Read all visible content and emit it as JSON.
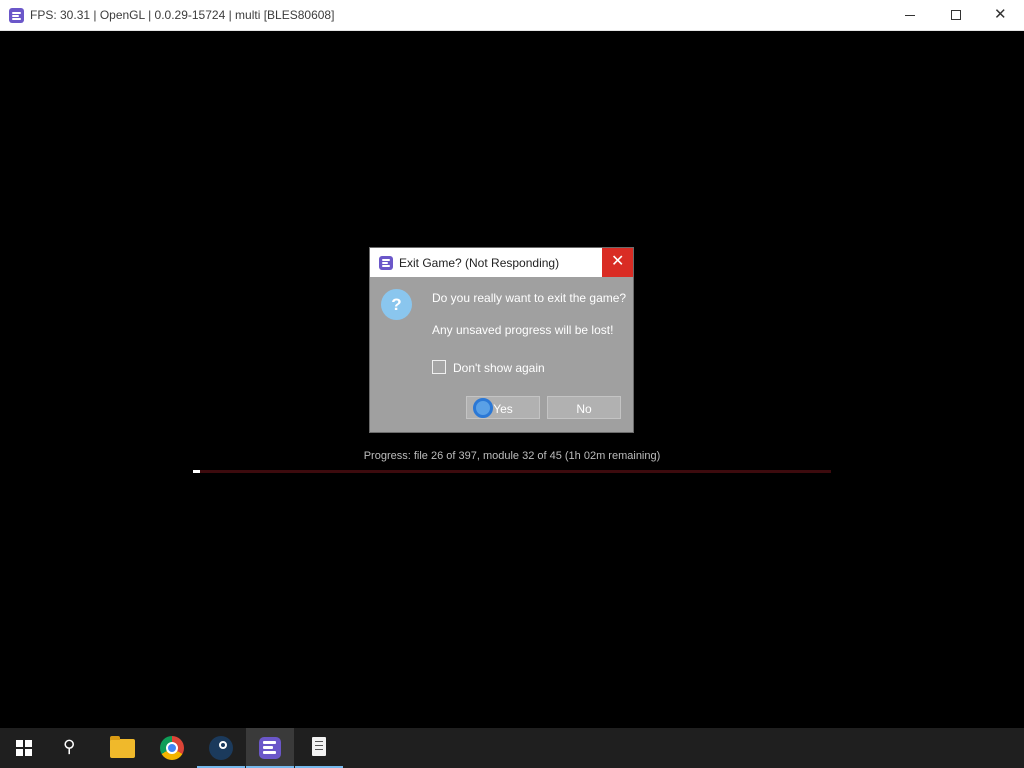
{
  "window": {
    "title": "FPS: 30.31 | OpenGL | 0.0.29-15724 | multi [BLES80608]",
    "icon": "rpcs3-app-icon",
    "controls": {
      "minimize_icon": "minimize-icon",
      "maximize_icon": "maximize-icon",
      "close_glyph": "✕"
    }
  },
  "dialog": {
    "title": "Exit Game? (Not Responding)",
    "close_glyph": "✕",
    "question_glyph": "?",
    "message_line1": "Do you really want to exit the game?",
    "message_line2": "Any unsaved progress will be lost!",
    "checkbox_label": "Don't show again",
    "checkbox_checked": false,
    "yes_label": "Yes",
    "no_label": "No",
    "colors": {
      "close_bg": "#d92c24",
      "body_bg": "#a0a0a0",
      "question_icon": "#8ac6ee"
    }
  },
  "progress": {
    "text": "Progress: file 26 of 397, module 32 of 45 (1h 02m remaining)",
    "fraction": 0.0117,
    "colors": {
      "track": "#3d0b0e",
      "fill": "#ffffff"
    }
  },
  "taskbar": {
    "items": [
      {
        "name": "start-button",
        "icon": "windows-logo-icon"
      },
      {
        "name": "search-button",
        "icon": "search-icon",
        "glyph": "⚲"
      },
      {
        "name": "file-explorer-button",
        "icon": "folder-icon",
        "running": false
      },
      {
        "name": "chrome-button",
        "icon": "chrome-icon",
        "running": false
      },
      {
        "name": "steam-button",
        "icon": "steam-icon",
        "running": true
      },
      {
        "name": "rpcs3-button",
        "icon": "rpcs3-icon",
        "running": true,
        "active": true
      },
      {
        "name": "document-app-button",
        "icon": "document-icon",
        "running": true
      }
    ],
    "colors": {
      "bg": "#1f1f1f",
      "running_underline": "#76b9ed"
    }
  }
}
